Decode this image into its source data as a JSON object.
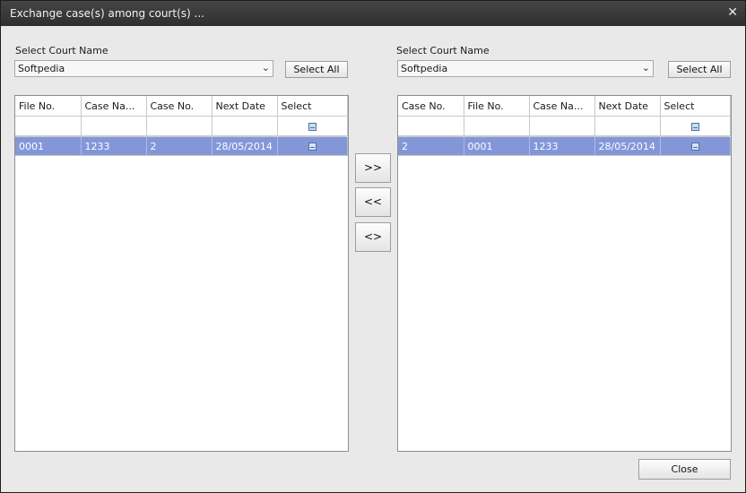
{
  "window": {
    "title": "Exchange case(s) among court(s) ..."
  },
  "left": {
    "court_label": "Select Court Name",
    "court_value": "Softpedia",
    "select_all": "Select All",
    "columns": [
      "File No.",
      "Case Na...",
      "Case No.",
      "Next Date",
      "Select"
    ],
    "rows": [
      {
        "cells": [
          "0001",
          "1233",
          "2",
          "28/05/2014"
        ],
        "selected": true
      }
    ]
  },
  "right": {
    "court_label": "Select Court Name",
    "court_value": "Softpedia",
    "select_all": "Select All",
    "columns": [
      "Case No.",
      "File No.",
      "Case Na...",
      "Next Date",
      "Select"
    ],
    "rows": [
      {
        "cells": [
          "2",
          "0001",
          "1233",
          "28/05/2014"
        ],
        "selected": true
      }
    ]
  },
  "transfer": {
    "move_right": ">>",
    "move_left": "<<",
    "swap": "<>"
  },
  "footer": {
    "close_label": "Close"
  },
  "icons": {
    "close": "close-icon",
    "dropdown": "chevron-down-icon",
    "checkbox": "checkbox-icon"
  }
}
